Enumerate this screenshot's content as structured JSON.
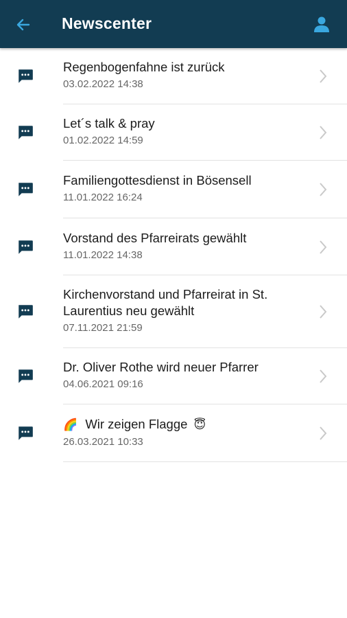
{
  "header": {
    "title": "Newscenter",
    "background_color": "#123c52",
    "back_icon": "arrow-left-icon",
    "profile_icon": "person-icon",
    "accent_color": "#3aa8e0"
  },
  "news": [
    {
      "title": "Regenbogenfahne ist zurück",
      "date": "03.02.2022 14:38"
    },
    {
      "title": "Let´s talk & pray",
      "date": "01.02.2022 14:59"
    },
    {
      "title": "Familiengottesdienst in Bösensell",
      "date": "11.01.2022 16:24"
    },
    {
      "title": "Vorstand des Pfarreirats gewählt",
      "date": "11.01.2022 14:38"
    },
    {
      "title_line1": "Kirchenvorstand und Pfarreirat in St.",
      "title_line2": "Laurentius neu gewählt",
      "date": "07.11.2021 21:59"
    },
    {
      "title": "Dr. Oliver Rothe wird neuer Pfarrer",
      "date": "04.06.2021 09:16"
    },
    {
      "emoji_before": "🌈",
      "title": "Wir zeigen Flagge",
      "emoji_after": "😇",
      "date": "26.03.2021 10:33"
    }
  ],
  "item_icon": "chat-bubble-icon",
  "item_chevron_icon": "chevron-right-icon"
}
